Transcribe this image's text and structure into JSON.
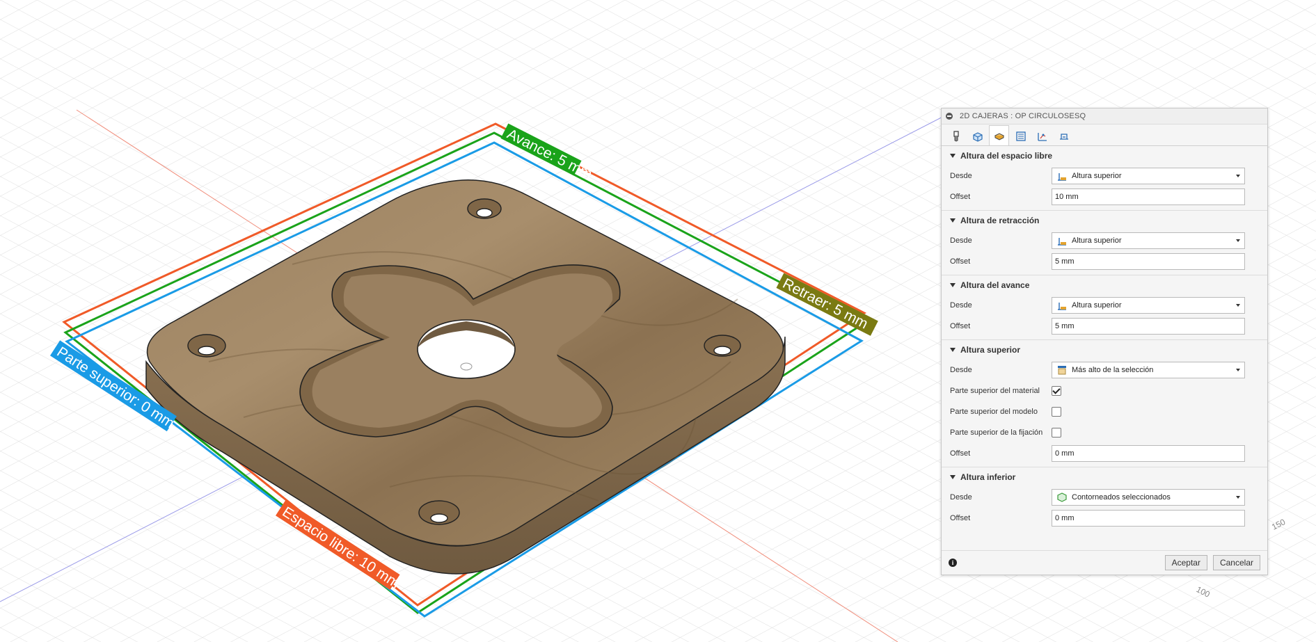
{
  "panel": {
    "title": "2D CAJERAS : OP CIRCULOSESQ",
    "tabs": [
      "tool-icon",
      "geometry-icon",
      "heights-icon",
      "passes-icon",
      "linking-icon",
      "stock-icon"
    ],
    "sections": {
      "clearance": {
        "label": "Altura del espacio libre",
        "from_label": "Desde",
        "from_value": "Altura superior",
        "offset_label": "Offset",
        "offset_value": "10 mm"
      },
      "retract": {
        "label": "Altura de retracción",
        "from_label": "Desde",
        "from_value": "Altura superior",
        "offset_label": "Offset",
        "offset_value": "5 mm"
      },
      "feed": {
        "label": "Altura del avance",
        "from_label": "Desde",
        "from_value": "Altura superior",
        "offset_label": "Offset",
        "offset_value": "5 mm"
      },
      "top": {
        "label": "Altura superior",
        "from_label": "Desde",
        "from_value": "Más alto de la selección",
        "stock_top_label": "Parte superior del material",
        "stock_top_checked": true,
        "model_top_label": "Parte superior del modelo",
        "model_top_checked": false,
        "fixture_top_label": "Parte superior de la fijación",
        "fixture_top_checked": false,
        "offset_label": "Offset",
        "offset_value": "0 mm"
      },
      "bottom": {
        "label": "Altura inferior",
        "from_label": "Desde",
        "from_value": "Contorneados seleccionados",
        "offset_label": "Offset",
        "offset_value": "0 mm"
      }
    },
    "ok_label": "Aceptar",
    "cancel_label": "Cancelar"
  },
  "viewport": {
    "labels": {
      "feed": "Avance: 5 mm",
      "retract": "Retraer: 5 mm",
      "top": "Parte superior: 0 mm",
      "clearance": "Espacio libre: 10 mm"
    },
    "axis_ticks": [
      "150",
      "100"
    ],
    "colors": {
      "clearance": "#f05a28",
      "feed": "#1aa31a",
      "retract_tag": "#7a7a12",
      "top": "#1a9be6",
      "wood": "#9c8260",
      "grid": "#d9d9d9"
    }
  }
}
